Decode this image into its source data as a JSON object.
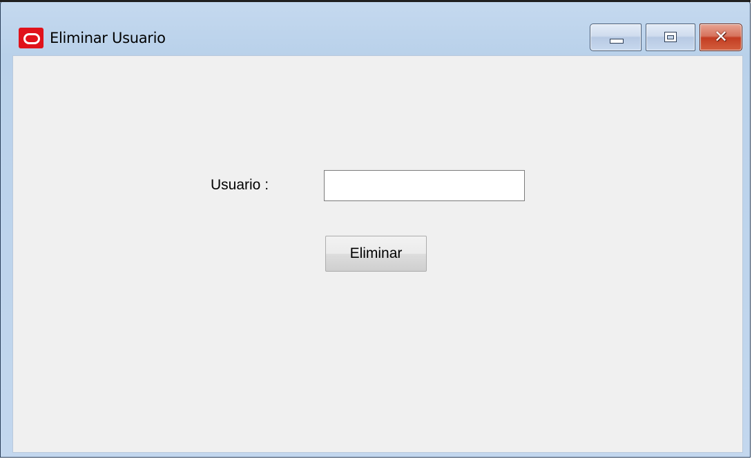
{
  "window": {
    "title": "Eliminar Usuario",
    "icon": "oracle-app-icon",
    "controls": {
      "minimize": "minimize-icon",
      "maximize": "maximize-icon",
      "close": "close-icon",
      "close_glyph": "✕"
    }
  },
  "form": {
    "user_label": "Usuario :",
    "user_value": "",
    "user_placeholder": "",
    "delete_button_label": "Eliminar"
  },
  "colors": {
    "client_background": "#f0f0f0",
    "icon_red": "#e0121b",
    "close_button_red": "#c33d22"
  }
}
